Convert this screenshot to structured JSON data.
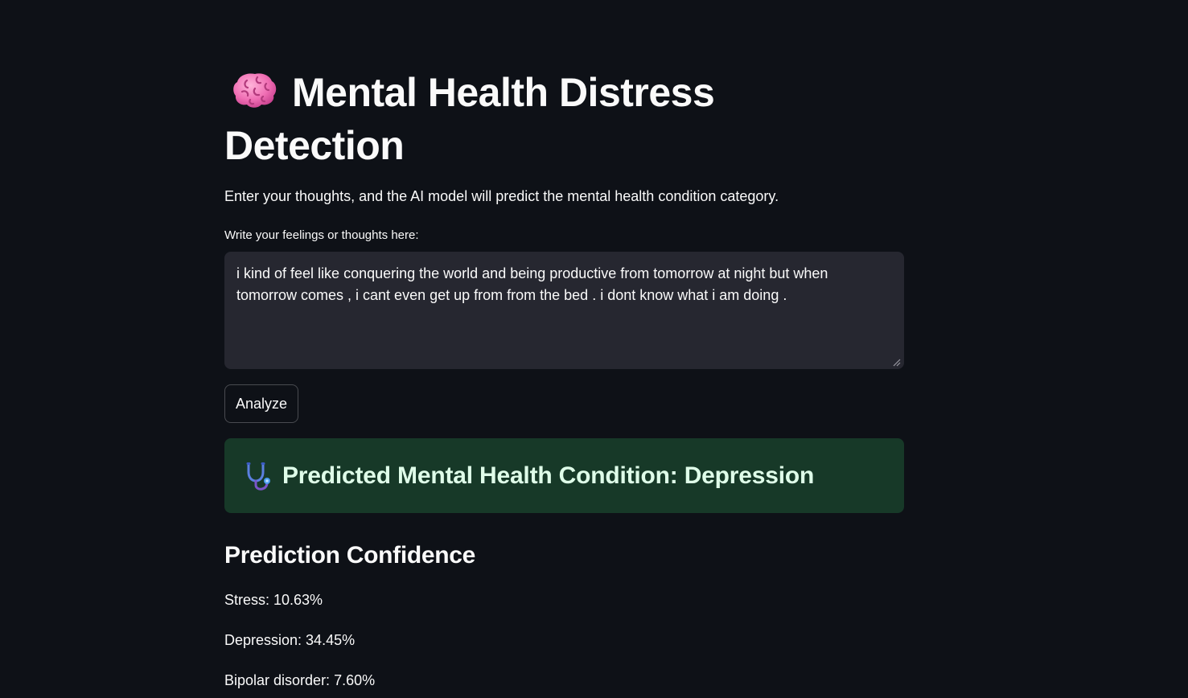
{
  "header": {
    "title": "Mental Health Distress Detection",
    "title_icon": "brain-icon",
    "subtitle": "Enter your thoughts, and the AI model will predict the mental health condition category."
  },
  "input": {
    "label": "Write your feelings or thoughts here:",
    "value": "i kind of feel like conquering the world and being productive from tomorrow at night but when tomorrow comes , i cant even get up from from the bed . i dont know what i am doing ."
  },
  "analyze_button": {
    "label": "Analyze"
  },
  "result": {
    "icon": "stethoscope-icon",
    "text": "Predicted Mental Health Condition: Depression",
    "bg_color": "#173928",
    "text_color": "#dffde9"
  },
  "confidence": {
    "title": "Prediction Confidence",
    "items": [
      {
        "text": "Stress: 10.63%"
      },
      {
        "text": "Depression: 34.45%"
      },
      {
        "text": "Bipolar disorder: 7.60%"
      }
    ]
  },
  "colors": {
    "background": "#0e1117",
    "input_background": "#262730",
    "text": "#fafafa"
  }
}
